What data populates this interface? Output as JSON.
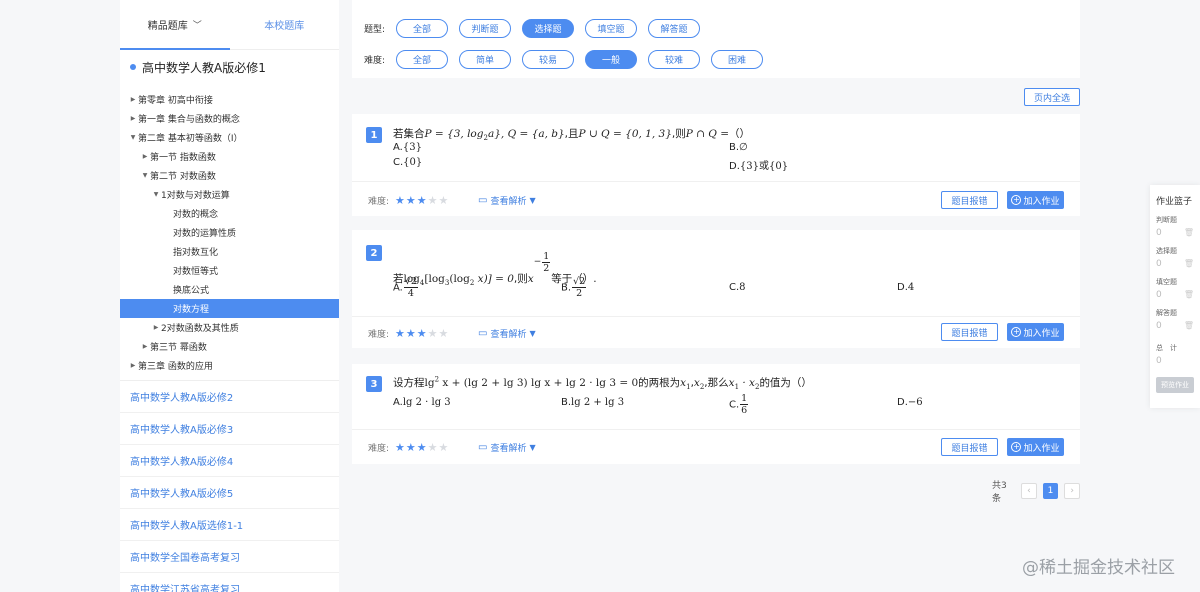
{
  "sidebar": {
    "tabs": [
      {
        "label": "精品题库"
      },
      {
        "label": "本校题库"
      }
    ],
    "book_title": "高中数学人教A版必修1",
    "tree": [
      {
        "label": "第零章 初高中衔接"
      },
      {
        "label": "第一章 集合与函数的概念"
      },
      {
        "label": "第二章 基本初等函数（I）"
      },
      {
        "label": "第一节 指数函数"
      },
      {
        "label": "第二节 对数函数"
      },
      {
        "label": "1对数与对数运算"
      },
      {
        "label": "对数的概念"
      },
      {
        "label": "对数的运算性质"
      },
      {
        "label": "指对数互化"
      },
      {
        "label": "对数恒等式"
      },
      {
        "label": "换底公式"
      },
      {
        "label": "对数方程"
      },
      {
        "label": "2对数函数及其性质"
      },
      {
        "label": "第三节 幂函数"
      },
      {
        "label": "第三章 函数的应用"
      }
    ],
    "books": [
      "高中数学人教A版必修2",
      "高中数学人教A版必修3",
      "高中数学人教A版必修4",
      "高中数学人教A版必修5",
      "高中数学人教A版选修1-1",
      "高中数学全国卷高考复习",
      "高中数学江苏省高考复习"
    ]
  },
  "filters": {
    "type_label": "题型:",
    "types": [
      "全部",
      "判断题",
      "选择题",
      "填空题",
      "解答题"
    ],
    "type_selected": "选择题",
    "difficulty_label": "难度:",
    "difficulties": [
      "全部",
      "简单",
      "较易",
      "一般",
      "较难",
      "困难"
    ],
    "difficulty_selected": "一般"
  },
  "select_all_label": "页内全选",
  "question_common": {
    "difficulty_label": "难度:",
    "analysis_label": "查看解析",
    "report_label": "题目报错",
    "add_label": "加入作业",
    "stars_filled": 3,
    "stars_total": 5
  },
  "questions": [
    {
      "number": "1",
      "stem_prefix": "若集合",
      "stem_math_1": "P = {3, log",
      "stem_sub_1": "2",
      "stem_math_2": "a}, Q = {a, b}",
      "stem_mid": ",且",
      "stem_math_3": "P ∪ Q = {0, 1, 3}",
      "stem_mid2": ",则",
      "stem_math_4": "P ∩ Q =",
      "stem_suffix": "（）",
      "options": [
        {
          "letter": "A.",
          "text": "{3}"
        },
        {
          "letter": "B.",
          "text": "∅"
        },
        {
          "letter": "C.",
          "text": "{0}"
        },
        {
          "letter": "D.",
          "text": "{3}或{0}"
        }
      ]
    },
    {
      "number": "2",
      "stem_prefix": "若",
      "stem_math": "log",
      "stem_sub_a": "4",
      "stem_math_b": "[log",
      "stem_sub_b": "3",
      "stem_math_c": "(log",
      "stem_sub_c": "2",
      "stem_math_d": " x)] = 0",
      "stem_mid": ",则",
      "stem_var": "x",
      "stem_exp_sign": "−",
      "stem_exp_num": "1",
      "stem_exp_den": "2",
      "stem_suffix": "等于（）.",
      "options": [
        {
          "letter": "A.",
          "num": "√2",
          "den": "4"
        },
        {
          "letter": "B.",
          "num": "√2",
          "den": "2"
        },
        {
          "letter": "C.",
          "text": "8"
        },
        {
          "letter": "D.",
          "text": "4"
        }
      ]
    },
    {
      "number": "3",
      "stem_prefix": "设方程",
      "stem_math_1": "lg",
      "stem_sup": "2",
      "stem_math_2": " x + (lg 2 + lg 3) lg x + lg 2 · lg 3 = 0",
      "stem_mid": "的两根为",
      "stem_math_3": "x",
      "stem_sub_3": "1",
      "stem_comma": ",",
      "stem_math_4": "x",
      "stem_sub_4": "2",
      "stem_mid2": ",那么",
      "stem_math_5": "x",
      "stem_sub_5": "1",
      "stem_math_6": " · x",
      "stem_sub_6": "2",
      "stem_suffix": "的值为（）",
      "options": [
        {
          "letter": "A.",
          "text": "lg 2 · lg 3"
        },
        {
          "letter": "B.",
          "text": "lg 2 + lg 3"
        },
        {
          "letter": "C.",
          "num": "1",
          "den": "6"
        },
        {
          "letter": "D.",
          "text": "−6"
        }
      ]
    }
  ],
  "pager": {
    "total": "共3条",
    "prev": "‹",
    "current": "1",
    "next": "›"
  },
  "basket": {
    "title": "作业篮子",
    "items": [
      {
        "label": "判断题",
        "count": "0"
      },
      {
        "label": "选择题",
        "count": "0"
      },
      {
        "label": "填空题",
        "count": "0"
      },
      {
        "label": "解答题",
        "count": "0"
      }
    ],
    "total_label": "总　计",
    "total_count": "0",
    "preview_label": "预览作业"
  },
  "watermark": "@稀土掘金技术社区",
  "colors": {
    "accent": "#4d8cf0",
    "link": "#3f7fe0",
    "background": "#f6f7f9"
  }
}
